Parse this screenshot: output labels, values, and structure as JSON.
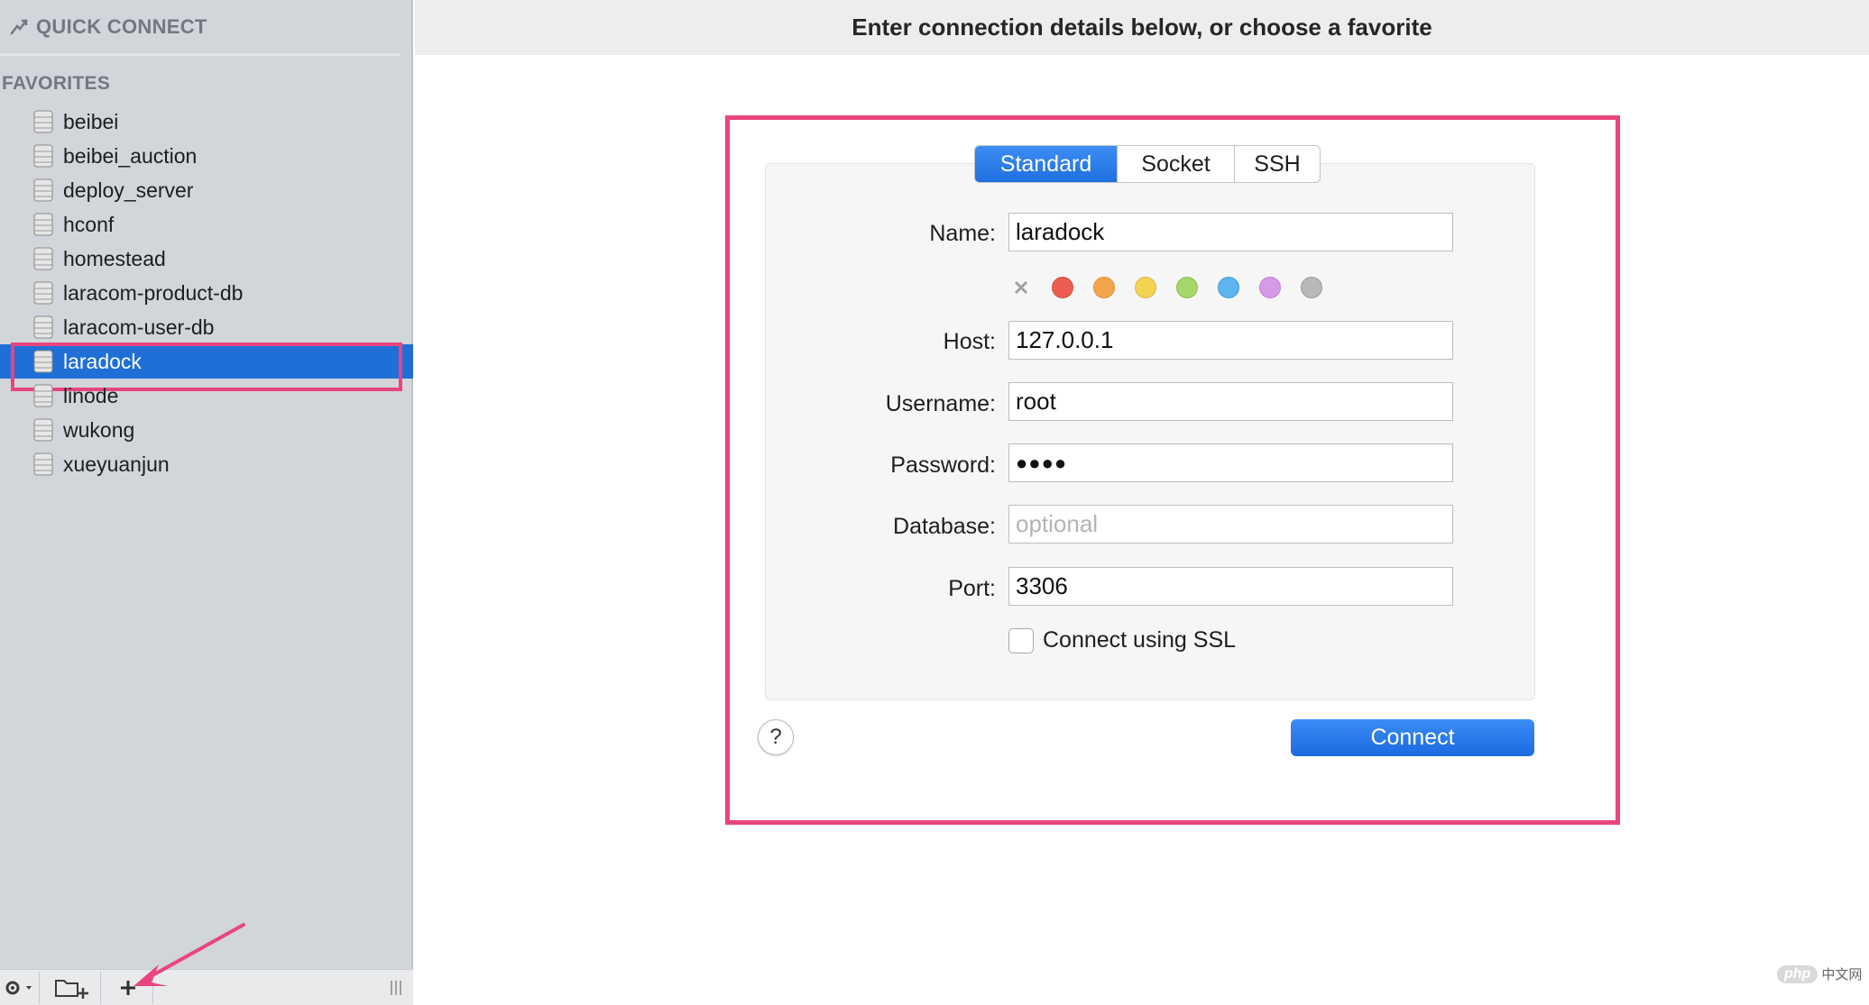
{
  "sidebar": {
    "quick_connect_label": "QUICK CONNECT",
    "favorites_header": "FAVORITES",
    "items": [
      {
        "label": "beibei"
      },
      {
        "label": "beibei_auction"
      },
      {
        "label": "deploy_server"
      },
      {
        "label": "hconf"
      },
      {
        "label": "homestead"
      },
      {
        "label": "laracom-product-db"
      },
      {
        "label": "laracom-user-db"
      },
      {
        "label": "laradock",
        "selected": true
      },
      {
        "label": "linode"
      },
      {
        "label": "wukong"
      },
      {
        "label": "xueyuanjun"
      }
    ],
    "bottom": {
      "settings_icon": "gear-icon",
      "new_folder_icon": "new-folder-icon",
      "add_icon": "plus-icon",
      "resize_icon": "resize-handle-icon"
    }
  },
  "main": {
    "header_title": "Enter connection details below, or choose a favorite",
    "tabs": [
      {
        "label": "Standard",
        "active": true
      },
      {
        "label": "Socket",
        "active": false
      },
      {
        "label": "SSH",
        "active": false
      }
    ],
    "form": {
      "name_label": "Name:",
      "name_value": "laradock",
      "host_label": "Host:",
      "host_value": "127.0.0.1",
      "username_label": "Username:",
      "username_value": "root",
      "password_label": "Password:",
      "password_value": "●●●●",
      "database_label": "Database:",
      "database_placeholder": "optional",
      "port_label": "Port:",
      "port_value": "3306",
      "ssl_label": "Connect using SSL",
      "ssl_checked": false
    },
    "color_tags": [
      "#ee5d52",
      "#f3a54a",
      "#f4d252",
      "#a4d66a",
      "#5db4ef",
      "#d69ae6",
      "#b8b8b8"
    ],
    "help_label": "?",
    "connect_label": "Connect"
  },
  "accents": {
    "highlight": "#e8457f",
    "selection": "#1f6fd7"
  },
  "watermark": {
    "logo": "php",
    "text": "中文网"
  }
}
